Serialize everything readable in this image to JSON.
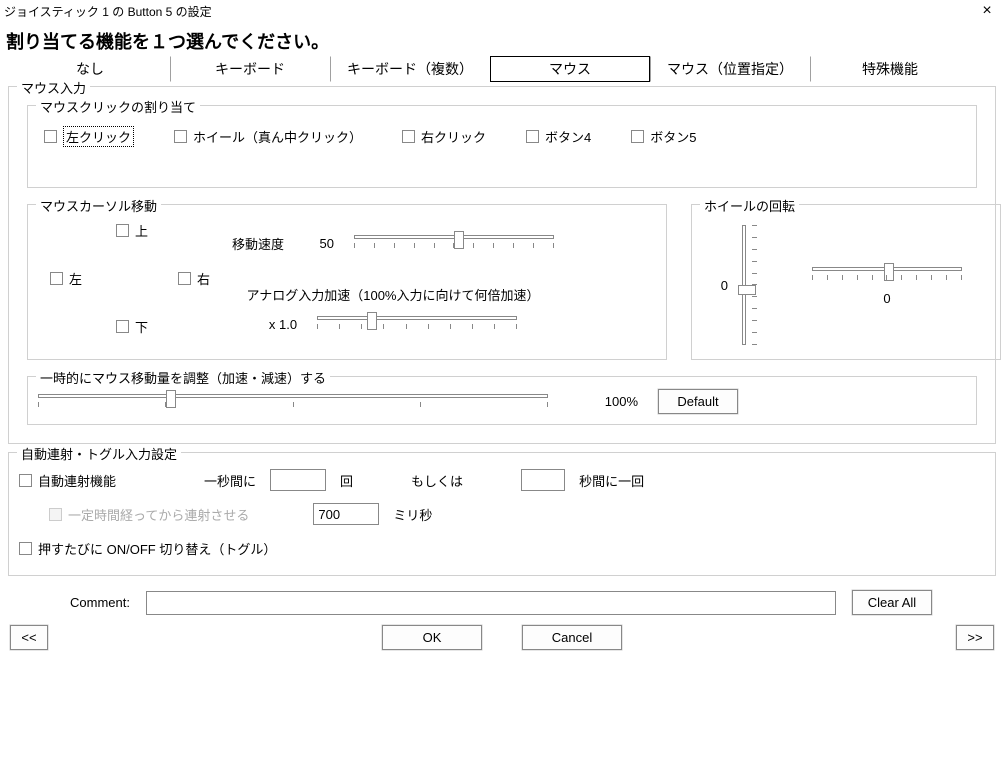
{
  "window": {
    "title": "ジョイスティック 1 の Button 5 の設定",
    "instruction": "割り当てる機能を１つ選んでください。"
  },
  "tabs": {
    "none": "なし",
    "keyboard": "キーボード",
    "keyboard_multi": "キーボード（複数）",
    "mouse": "マウス",
    "mouse_pos": "マウス（位置指定）",
    "special": "特殊機能"
  },
  "mouse_input": {
    "legend": "マウス入力",
    "click_assign": {
      "legend": "マウスクリックの割り当て",
      "left": "左クリック",
      "wheel": "ホイール（真ん中クリック）",
      "right": "右クリック",
      "button4": "ボタン4",
      "button5": "ボタン5"
    },
    "cursor_move": {
      "legend": "マウスカーソル移動",
      "up": "上",
      "down": "下",
      "left": "左",
      "right": "右",
      "speed_label": "移動速度",
      "speed_value": "50",
      "analog_label": "アナログ入力加速（100%入力に向けて何倍加速）",
      "analog_value": "x 1.0"
    },
    "wheel": {
      "legend": "ホイールの回転",
      "v_value": "0",
      "h_value": "0"
    },
    "temp_adjust": {
      "legend": "一時的にマウス移動量を調整（加速・減速）する",
      "percent": "100%",
      "default_btn": "Default"
    }
  },
  "autofire": {
    "legend": "自動連射・トグル入力設定",
    "enable": "自動連射機能",
    "per_sec_pre": "一秒間に",
    "per_sec_suf": "回",
    "or_label": "もしくは",
    "per_interval_suf": "秒間に一回",
    "delay_label": "一定時間経ってから連射させる",
    "delay_value": "700",
    "delay_unit": "ミリ秒",
    "toggle": "押すたびに ON/OFF 切り替え（トグル）"
  },
  "comment": {
    "label": "Comment:",
    "value": ""
  },
  "buttons": {
    "clear_all": "Clear All",
    "ok": "OK",
    "cancel": "Cancel",
    "prev": "<<",
    "next": ">>"
  }
}
